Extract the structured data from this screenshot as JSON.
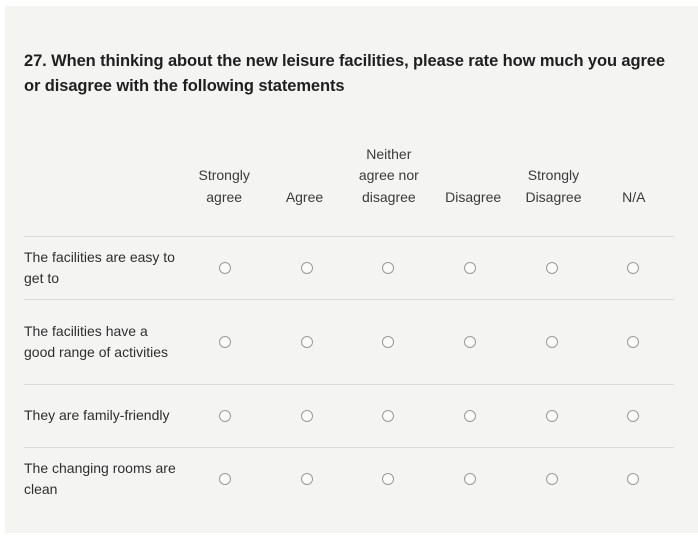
{
  "question": {
    "number": "27.",
    "text": "27. When thinking about the new leisure facilities, please rate how much you agree or disagree with the following statements"
  },
  "matrix": {
    "columns": [
      {
        "label": "Strongly agree"
      },
      {
        "label": "Agree"
      },
      {
        "label": "Neither agree nor disagree"
      },
      {
        "label": "Disagree"
      },
      {
        "label": "Strongly Disagree"
      },
      {
        "label": "N/A"
      }
    ],
    "rows": [
      {
        "label": "The facilities are easy to get to",
        "selected": null
      },
      {
        "label": "The facilities have a good range of activities",
        "selected": null
      },
      {
        "label": "They are family-friendly",
        "selected": null
      },
      {
        "label": "The changing rooms are clean",
        "selected": null
      }
    ]
  },
  "colors": {
    "page_background": "#f4f4f2",
    "outer_background": "#ffffff",
    "title_text": "#1f1f1f",
    "body_text": "#2e2e2e",
    "header_text": "#3a3a3a",
    "divider": "#dddbd8",
    "radio_border": "#9a9a9a"
  }
}
